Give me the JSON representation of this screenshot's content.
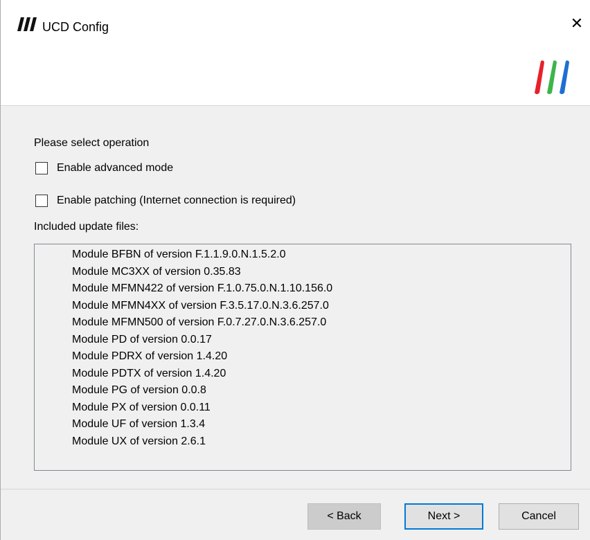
{
  "window": {
    "title": "UCD Config",
    "close_glyph": "✕"
  },
  "icons": {
    "app": "ucd-logo-icon",
    "brand": "ucd-brand-logo-icon"
  },
  "colors": {
    "brand_red": "#e8202a",
    "brand_green": "#3db54a",
    "brand_blue": "#1e6fd1",
    "focus_border": "#0078d7"
  },
  "main": {
    "prompt": "Please select operation",
    "options": [
      {
        "label": "Enable advanced mode",
        "checked": false
      },
      {
        "label": "Enable patching (Internet connection is required)",
        "checked": false
      }
    ],
    "included_label": "Included update files:",
    "files": [
      "Module BFBN of version F.1.1.9.0.N.1.5.2.0",
      "Module MC3XX of version 0.35.83",
      "Module MFMN422 of version F.1.0.75.0.N.1.10.156.0",
      "Module MFMN4XX of version F.3.5.17.0.N.3.6.257.0",
      "Module MFMN500 of version F.0.7.27.0.N.3.6.257.0",
      "Module PD of version 0.0.17",
      "Module PDRX of version 1.4.20",
      "Module PDTX of version 1.4.20",
      "Module PG of version 0.0.8",
      "Module PX of version 0.0.11",
      "Module UF of version 1.3.4",
      "Module UX of version 2.6.1"
    ]
  },
  "buttons": {
    "back": "< Back",
    "next": "Next >",
    "cancel": "Cancel"
  }
}
